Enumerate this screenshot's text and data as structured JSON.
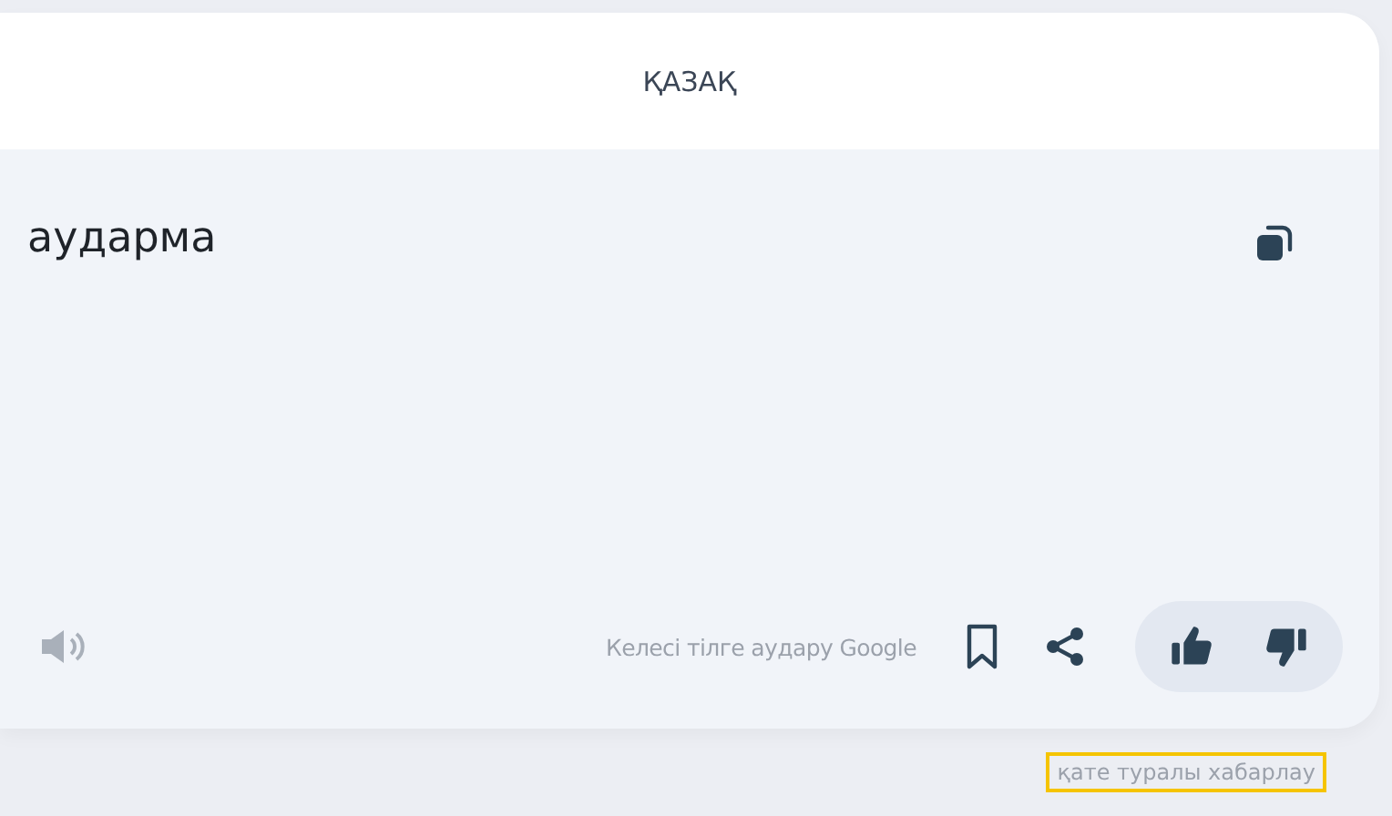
{
  "header": {
    "language": "ҚАЗАҚ"
  },
  "translation": {
    "text": "аударма"
  },
  "footer": {
    "next_language_hint": "Келесі тілге аудару Google"
  },
  "report_link": {
    "label": "қате туралы хабарлау",
    "highlighted": true
  }
}
